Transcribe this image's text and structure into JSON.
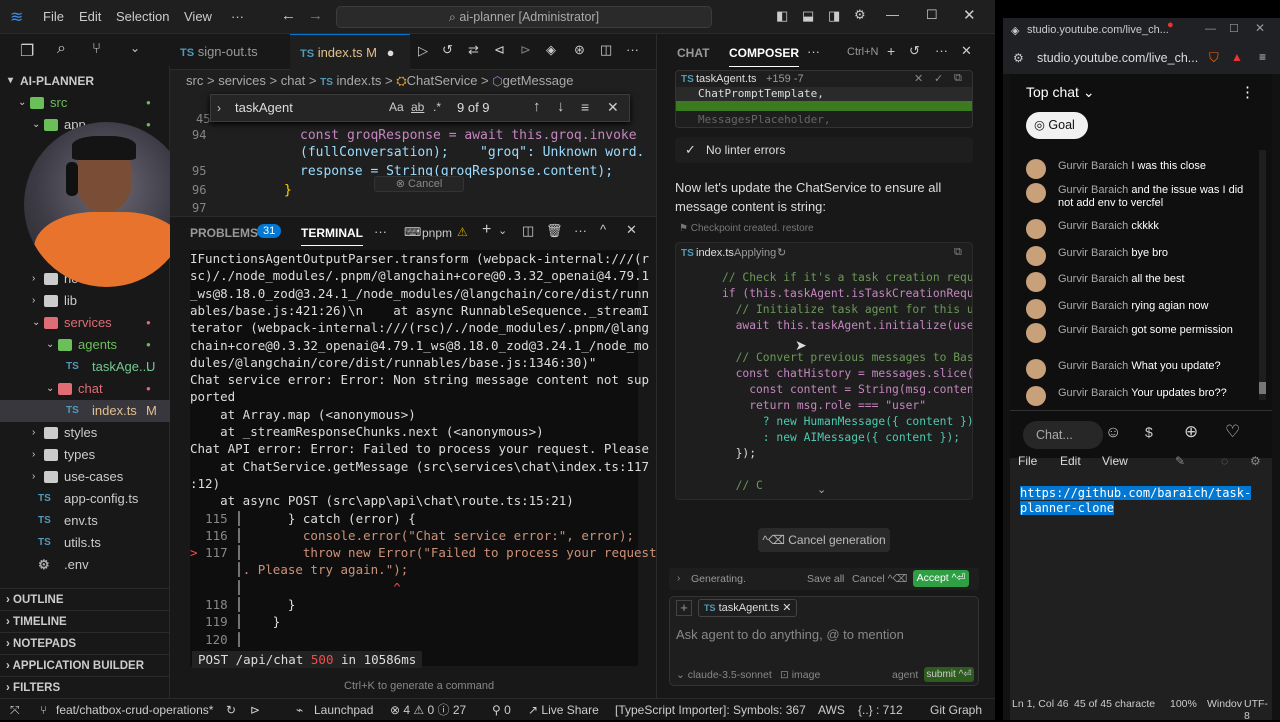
{
  "titlebar": {
    "menus": [
      "File",
      "Edit",
      "Selection",
      "View",
      "···"
    ],
    "search": "ai-planner [Administrator]"
  },
  "sidebar": {
    "root": "AI-PLANNER",
    "items": [
      {
        "label": "src",
        "type": "folder",
        "depth": 1,
        "color": "#6bbf59"
      },
      {
        "label": "app",
        "type": "folder",
        "depth": 2,
        "color": "#6bbf59"
      },
      {
        "label": "hooks",
        "type": "folder",
        "depth": 2,
        "color": "#ccc"
      },
      {
        "label": "lib",
        "type": "folder",
        "depth": 2,
        "color": "#ccc"
      },
      {
        "label": "services",
        "type": "folder",
        "depth": 2,
        "color": "#e06c75"
      },
      {
        "label": "agents",
        "type": "folder",
        "depth": 3,
        "color": "#6bbf59"
      },
      {
        "label": "taskAge...",
        "badge": "U",
        "type": "file",
        "depth": 4,
        "color": "#73c991"
      },
      {
        "label": "chat",
        "type": "folder",
        "depth": 3,
        "color": "#e06c75"
      },
      {
        "label": "index.ts",
        "badge": "M",
        "type": "file",
        "depth": 4,
        "color": "#e2c08d"
      },
      {
        "label": "styles",
        "type": "folder",
        "depth": 2,
        "color": "#ccc"
      },
      {
        "label": "types",
        "type": "folder",
        "depth": 2,
        "color": "#ccc"
      },
      {
        "label": "use-cases",
        "type": "folder",
        "depth": 2,
        "color": "#ccc"
      },
      {
        "label": "app-config.ts",
        "type": "file",
        "depth": 2,
        "color": "#ccc"
      },
      {
        "label": "env.ts",
        "type": "file",
        "depth": 2,
        "color": "#ccc"
      },
      {
        "label": "utils.ts",
        "type": "file",
        "depth": 2,
        "color": "#ccc"
      },
      {
        "label": ".env",
        "type": "file",
        "depth": 2,
        "color": "#888"
      }
    ],
    "sections": [
      "OUTLINE",
      "TIMELINE",
      "NOTEPADS",
      "APPLICATION BUILDER",
      "FILTERS"
    ]
  },
  "editor": {
    "tabs": [
      {
        "label": "sign-out.ts",
        "badge": ""
      },
      {
        "label": "index.ts",
        "badge": "M"
      }
    ],
    "breadcrumb": [
      "src",
      ">",
      "services",
      ">",
      "chat",
      ">",
      "index.ts",
      ">",
      "ChatService",
      ">",
      "getMessage"
    ],
    "find": {
      "query": "taskAgent",
      "result": "9 of 9",
      "opt1": "Aa",
      "opt2": "ab",
      "opt3": ".*"
    },
    "lines": [
      {
        "num": "94",
        "code": "const groqResponse = await this.groq.invoke"
      },
      {
        "num": "",
        "code": "(fullConversation);    \"groq\": Unknown word."
      },
      {
        "num": "95",
        "code": "response = String(groqResponse.content);"
      },
      {
        "num": "96",
        "code": "}"
      },
      {
        "num": "97",
        "code": ""
      }
    ],
    "cancel_hint": "Cancel",
    "line45": "45"
  },
  "panel": {
    "tabs": {
      "problems": "PROBLEMS",
      "problems_count": "31",
      "terminal": "TERMINAL",
      "more": "···",
      "shell": "pnpm"
    },
    "terminal_lines": [
      "IFunctionsAgentOutputParser.transform (webpack-internal:///(r",
      "sc)/./node_modules/.pnpm/@langchain+core@0.3.32_openai@4.79.1",
      "_ws@8.18.0_zod@3.24.1_/node_modules/@langchain/core/dist/runn",
      "ables/base.js:421:26)\\n    at async RunnableSequence._streamI",
      "terator (webpack-internal:///(rsc)/./node_modules/.pnpm/@lang",
      "chain+core@0.3.32_openai@4.79.1_ws@8.18.0_zod@3.24.1_/node_mo",
      "dules/@langchain/core/dist/runnables/base.js:1346:30)\"",
      "Chat service error: Error: Non string message content not sup",
      "ported",
      "    at Array.map (<anonymous>)",
      "    at _streamResponseChunks.next (<anonymous>)",
      "Chat API error: Error: Failed to process your request. Please",
      "    at ChatService.getMessage (src\\services\\chat\\index.ts:117",
      ":12)",
      "    at async POST (src\\app\\api\\chat\\route.ts:15:21)"
    ],
    "code_frame": [
      {
        "num": "115",
        "text": "      } catch (error) {"
      },
      {
        "num": "116",
        "text": "        console.error(\"Chat service error:\", error);"
      },
      {
        "num": "117",
        "text": "        throw new Error(\"Failed to process your request"
      },
      {
        "num": "",
        "text": ". Please try again.\");"
      },
      {
        "num": "",
        "text": "                    ^"
      },
      {
        "num": "118",
        "text": "      }"
      },
      {
        "num": "119",
        "text": "    }"
      },
      {
        "num": "120",
        "text": ""
      }
    ],
    "post_line": "POST /api/chat 500 in 10586ms",
    "post_method": "POST /api/chat",
    "post_status": "500",
    "post_time": "in 10586ms",
    "hint": "Ctrl+K to generate a command"
  },
  "chat": {
    "tabs": [
      "CHAT",
      "COMPOSER"
    ],
    "shortcut": "Ctrl+N",
    "file_header": "taskAgent.ts",
    "diff": "+159 -7",
    "snippet_lines": [
      "ChatPromptTemplate,",
      "MessagesPlaceholder,"
    ],
    "linter": "No linter errors",
    "message": "Now let's update the ChatService to ensure all message content is string:",
    "checkpoint": "Checkpoint created.",
    "restore": "restore",
    "code_file": "index.ts",
    "code_state": "Applying",
    "code_lines": [
      "// Check if it's a task creation requ",
      "if (this.taskAgent.isTaskCreationRequ",
      "  // Initialize task agent for this u",
      "  await this.taskAgent.initialize(use",
      "",
      "  // Convert previous messages to Bas",
      "  const chatHistory = messages.slice(",
      "    const content = String(msg.conten",
      "    return msg.role === \"user\"",
      "      ? new HumanMessage({ content })",
      "      : new AIMessage({ content });",
      "  });",
      "",
      "  // C"
    ],
    "cancel_generation": "^⌫ Cancel generation",
    "generating": "Generating.",
    "save_all": "Save all",
    "cancel": "Cancel ^⌫",
    "accept": "Accept ^⏎",
    "context_file": "taskAgent.ts",
    "input_placeholder": "Ask agent to do anything, @ to mention",
    "model": "claude-3.5-sonnet",
    "image": "image",
    "mode": "agent",
    "submit": "submit ^⏎"
  },
  "status": {
    "branch": "feat/chatbox-crud-operations*",
    "launchpad": "Launchpad",
    "errors": "4",
    "warnings": "0",
    "infos": "27",
    "ports": "0",
    "live_share": "Live Share",
    "ts": "[TypeScript Importer]: Symbols: 367",
    "aws": "AWS",
    "sel": "{..} : 712",
    "git_graph": "Git Graph"
  },
  "browser": {
    "tab_title": "studio.youtube.com/live_ch...",
    "url": "studio.youtube.com/live_ch...",
    "chat_title": "Top chat",
    "goal": "Goal",
    "chat_placeholder": "Chat...",
    "messages": [
      {
        "user": "Gurvir Baraich",
        "text": "I was this close"
      },
      {
        "user": "Gurvir Baraich",
        "text": "and the issue was I did not add env to vercfel"
      },
      {
        "user": "Gurvir Baraich",
        "text": "ckkkk"
      },
      {
        "user": "Gurvir Baraich",
        "text": "bye bro"
      },
      {
        "user": "Gurvir Baraich",
        "text": "all the best"
      },
      {
        "user": "Gurvir Baraich",
        "text": "rying agian now"
      },
      {
        "user": "Gurvir Baraich",
        "text": "got some permission"
      },
      {
        "user": "Gurvir Baraich",
        "text": "What you update?"
      },
      {
        "user": "Gurvir Baraich",
        "text": "Your updates bro??"
      }
    ],
    "notepad_menus": [
      "File",
      "Edit",
      "View"
    ],
    "notepad_text": "https://github.com/baraich/task-planner-clone",
    "notepad_status": [
      "Ln 1, Col 46",
      "45 of 45 characte",
      "100%",
      "Windov",
      "UTF-8"
    ]
  }
}
